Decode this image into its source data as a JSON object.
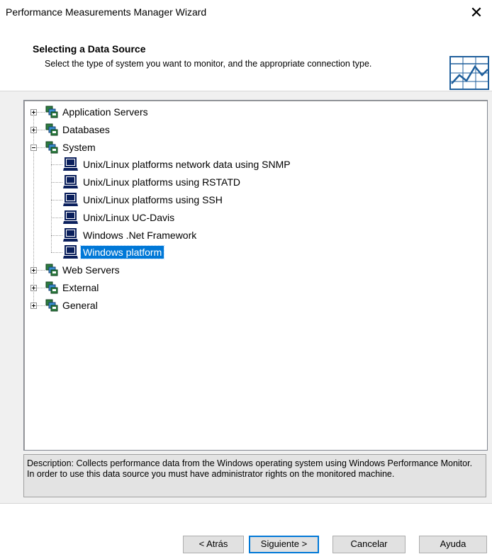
{
  "window": {
    "title": "Performance Measurements Manager Wizard",
    "close_glyph": "✕"
  },
  "header": {
    "title": "Selecting a Data Source",
    "subtitle": "Select the type of system you want to monitor, and the appropriate connection type.",
    "icon": "chart-icon"
  },
  "tree": {
    "items": [
      {
        "label": "Application Servers",
        "level": 0,
        "expander": "plus",
        "icon": "group-icon"
      },
      {
        "label": "Databases",
        "level": 0,
        "expander": "plus",
        "icon": "group-icon"
      },
      {
        "label": "System",
        "level": 0,
        "expander": "minus",
        "icon": "group-icon"
      },
      {
        "label": "Unix/Linux platforms network data using SNMP",
        "level": 1,
        "icon": "computer-icon"
      },
      {
        "label": "Unix/Linux platforms using RSTATD",
        "level": 1,
        "icon": "computer-icon"
      },
      {
        "label": "Unix/Linux platforms using SSH",
        "level": 1,
        "icon": "computer-icon"
      },
      {
        "label": "Unix/Linux UC-Davis",
        "level": 1,
        "icon": "computer-icon"
      },
      {
        "label": "Windows .Net Framework",
        "level": 1,
        "icon": "computer-icon"
      },
      {
        "label": "Windows platform",
        "level": 1,
        "icon": "computer-icon",
        "selected": true
      },
      {
        "label": "Web Servers",
        "level": 0,
        "expander": "plus",
        "icon": "group-icon"
      },
      {
        "label": "External",
        "level": 0,
        "expander": "plus",
        "icon": "group-icon"
      },
      {
        "label": "General",
        "level": 0,
        "expander": "plus",
        "icon": "group-icon"
      }
    ]
  },
  "description": {
    "line1": "Description: Collects performance data from the Windows operating system using Windows Performance Monitor.",
    "line2": "In order to use this data source you must have administrator rights on the monitored machine."
  },
  "buttons": {
    "back": "< Atrás",
    "next": "Siguiente >",
    "cancel": "Cancelar",
    "help": "Ayuda"
  },
  "colors": {
    "selection": "#0078d7",
    "accent": "#1f5f9c"
  }
}
